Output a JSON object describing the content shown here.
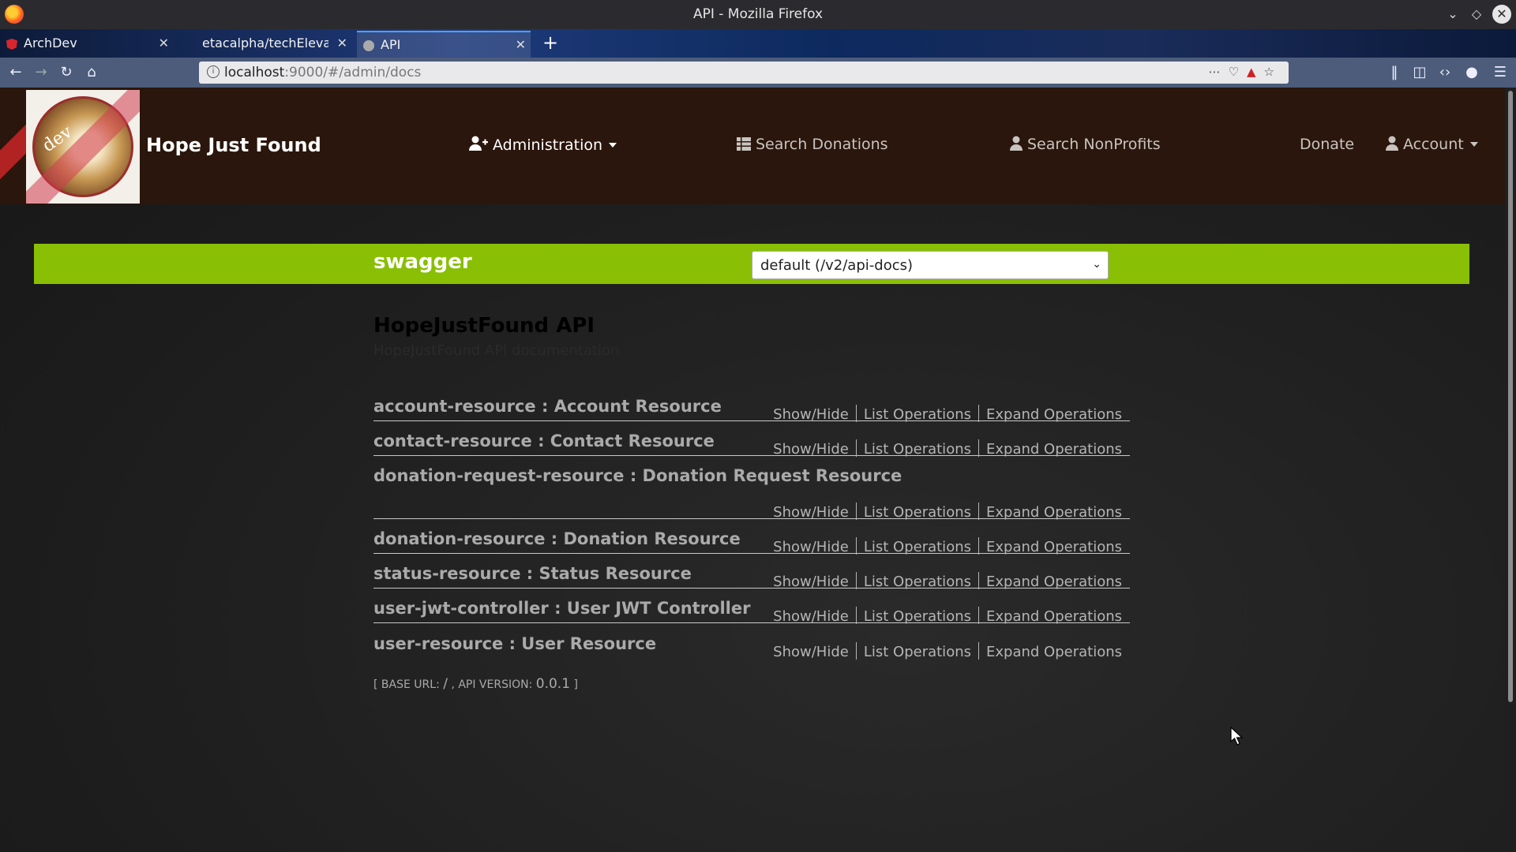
{
  "window": {
    "title": "API - Mozilla Firefox"
  },
  "tabs": [
    {
      "label": "ArchDev",
      "icon": "angular-icon"
    },
    {
      "label": "etacalpha/techElevat",
      "icon": "github-icon"
    },
    {
      "label": "API",
      "icon": "swagger-icon"
    }
  ],
  "url": {
    "host": "localhost",
    "rest": ":9000/#/admin/docs"
  },
  "app": {
    "brand": "Hope Just Found",
    "logo_text": "dev",
    "menu": {
      "administration": "Administration",
      "search_donations": "Search Donations",
      "search_nonprofits": "Search NonProfits",
      "donate": "Donate",
      "account": "Account"
    }
  },
  "swagger": {
    "logo": "swagger",
    "spec_selected": "default (/v2/api-docs)",
    "api_title": "HopeJustFound API",
    "api_description": "HopeJustFound API documentation",
    "ops_labels": {
      "show_hide": "Show/Hide",
      "list": "List Operations",
      "expand": "Expand Operations"
    },
    "resources": [
      "account-resource : Account Resource",
      "contact-resource : Contact Resource",
      "donation-request-resource : Donation Request Resource",
      "donation-resource : Donation Resource",
      "status-resource : Status Resource",
      "user-jwt-controller : User JWT Controller",
      "user-resource : User Resource"
    ],
    "base_url_label": "BASE URL",
    "base_url_value": "/",
    "api_version_label": "API VERSION",
    "api_version_value": "0.0.1"
  },
  "colors": {
    "swagger_green": "#89bf04",
    "header_bg": "#2a160c"
  }
}
